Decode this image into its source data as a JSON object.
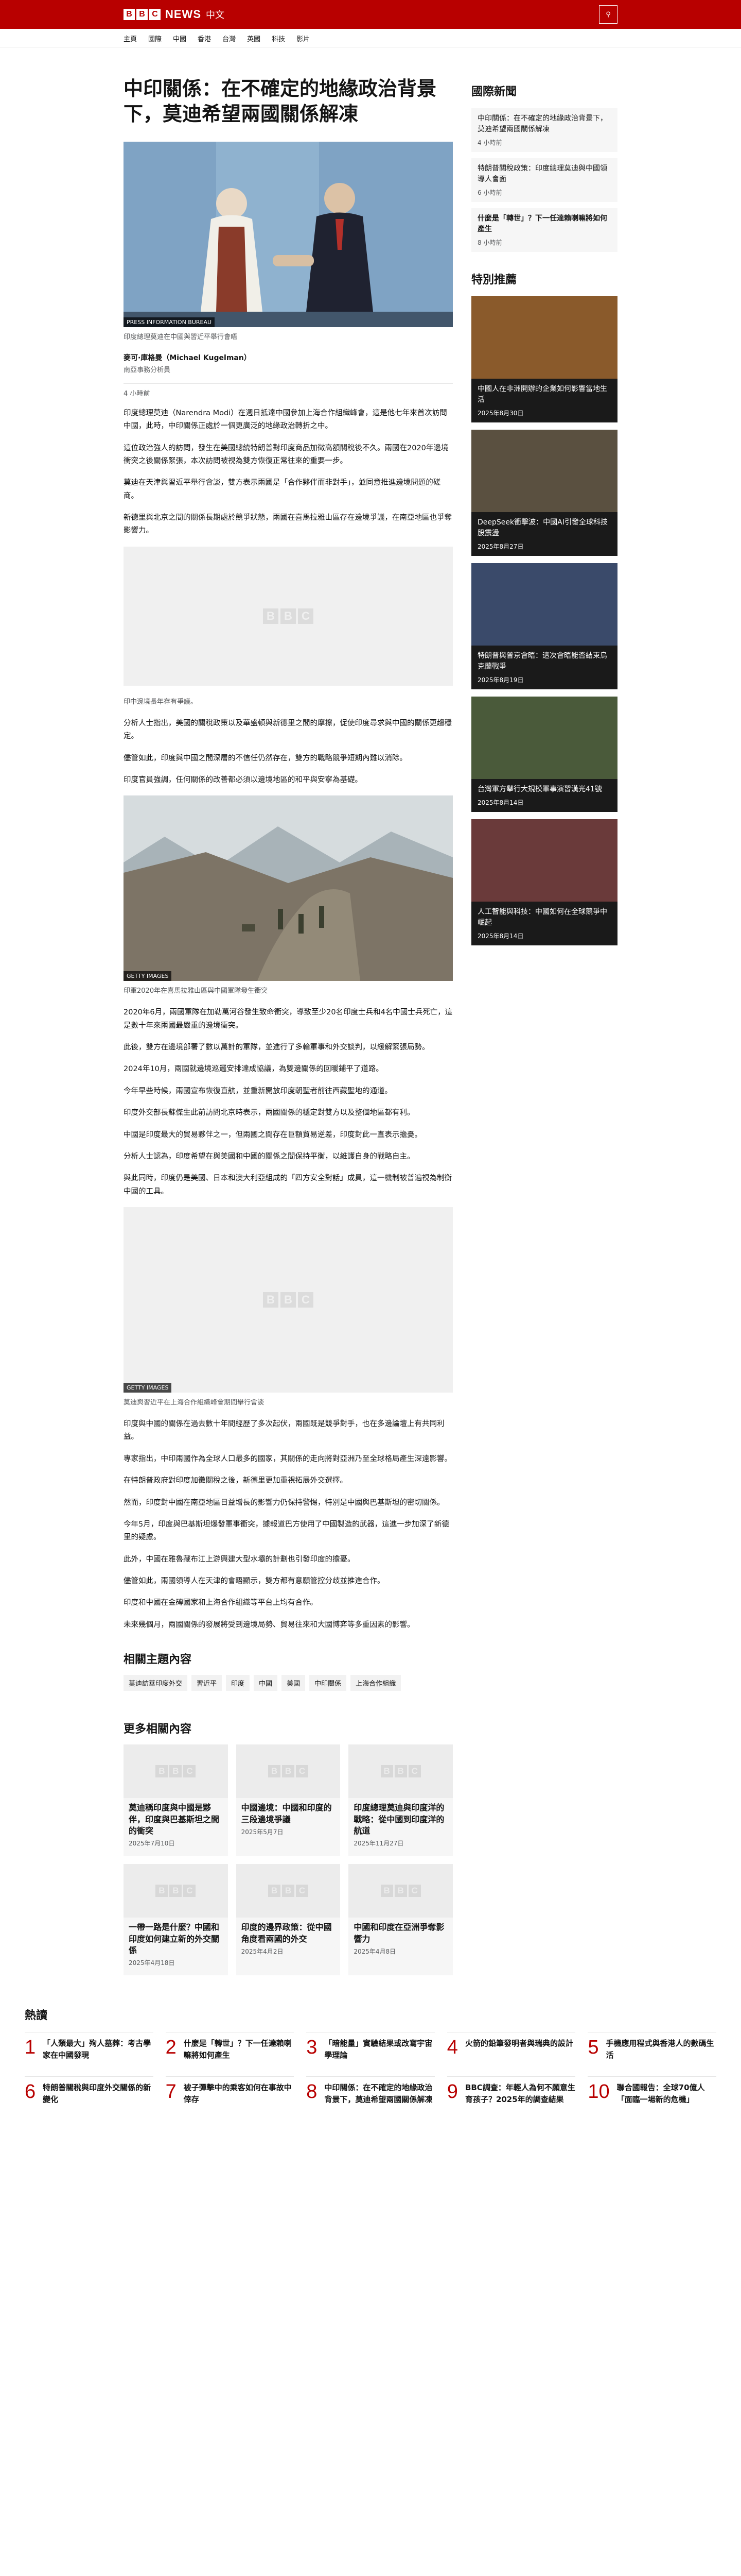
{
  "brand": {
    "letters": [
      "B",
      "B",
      "C"
    ],
    "news": "NEWS",
    "zh": "中文"
  },
  "nav": [
    "主頁",
    "國際",
    "中國",
    "香港",
    "台灣",
    "英國",
    "科技",
    "影片"
  ],
  "article": {
    "title": "中印關係：在不確定的地緣政治背景下，莫迪希望兩國關係解凍",
    "hero_credit": "PRESS INFORMATION BUREAU",
    "hero_caption": "印度總理莫迪在中國與習近平舉行會晤",
    "author": "麥可·庫格曼（Michael Kugelman）",
    "author_role": "南亞事務分析員",
    "date": "4 小時前",
    "paragraphs_a": [
      "印度總理莫迪（Narendra Modi）在週日抵達中國參加上海合作組織峰會，這是他七年來首次訪問中國，此時，中印關係正處於一個更廣泛的地緣政治轉折之中。",
      "這位政治強人的訪問，發生在美國總統特朗普對印度商品加徵高額關稅後不久。兩國在2020年邊境衝突之後關係緊張，本次訪問被視為雙方恢復正常往來的重要一步。",
      "莫迪在天津與習近平舉行會談，雙方表示兩國是「合作夥伴而非對手」，並同意推進邊境問題的磋商。",
      "新德里與北京之間的關係長期處於競爭狀態，兩國在喜馬拉雅山區存在邊境爭議，在南亞地區也爭奪影響力。"
    ],
    "ph1_caption": "印中邊境長年存有爭議。",
    "paragraphs_b": [
      "分析人士指出，美國的關稅政策以及華盛頓與新德里之間的摩擦，促使印度尋求與中國的關係更趨穩定。",
      "儘管如此，印度與中國之間深層的不信任仍然存在，雙方的戰略競爭短期內難以消除。",
      "印度官員強調，任何關係的改善都必須以邊境地區的和平與安寧為基礎。"
    ],
    "fig2_credit": "GETTY IMAGES",
    "fig2_caption": "印軍2020年在喜馬拉雅山區與中國軍隊發生衝突",
    "paragraphs_c": [
      "2020年6月，兩國軍隊在加勒萬河谷發生致命衝突，導致至少20名印度士兵和4名中國士兵死亡，這是數十年來兩國最嚴重的邊境衝突。",
      "此後，雙方在邊境部署了數以萬計的軍隊，並進行了多輪軍事和外交談判，以緩解緊張局勢。",
      "2024年10月，兩國就邊境巡邏安排達成協議，為雙邊關係的回暖鋪平了道路。",
      "今年早些時候，兩國宣布恢復直航，並重新開放印度朝聖者前往西藏聖地的通道。",
      "印度外交部長蘇傑生此前訪問北京時表示，兩國關係的穩定對雙方以及整個地區都有利。",
      "中國是印度最大的貿易夥伴之一，但兩國之間存在巨額貿易逆差，印度對此一直表示擔憂。",
      "分析人士認為，印度希望在與美國和中國的關係之間保持平衡，以維護自身的戰略自主。",
      "與此同時，印度仍是美國、日本和澳大利亞組成的「四方安全對話」成員，這一機制被普遍視為制衡中國的工具。"
    ],
    "ph2_credit": "GETTY IMAGES",
    "ph2_caption": "莫迪與習近平在上海合作組織峰會期間舉行會談",
    "paragraphs_d": [
      "印度與中國的關係在過去數十年間經歷了多次起伏，兩國既是競爭對手，也在多邊論壇上有共同利益。",
      "專家指出，中印兩國作為全球人口最多的國家，其關係的走向將對亞洲乃至全球格局產生深遠影響。",
      "在特朗普政府對印度加徵關稅之後，新德里更加重視拓展外交選擇。",
      "然而，印度對中國在南亞地區日益增長的影響力仍保持警惕，特別是中國與巴基斯坦的密切關係。",
      "今年5月，印度與巴基斯坦爆發軍事衝突，據報道巴方使用了中國製造的武器，這進一步加深了新德里的疑慮。",
      "此外，中國在雅魯藏布江上游興建大型水壩的計劃也引發印度的擔憂。",
      "儘管如此，兩國領導人在天津的會晤顯示，雙方都有意願管控分歧並推進合作。",
      "印度和中國在金磚國家和上海合作組織等平台上均有合作。",
      "未來幾個月，兩國關係的發展將受到邊境局勢、貿易往來和大國博弈等多重因素的影響。"
    ]
  },
  "related_topics": {
    "title": "相關主題內容",
    "tags": [
      "莫迪訪華印度外交",
      "習近平",
      "印度",
      "中國",
      "美國",
      "中印關係",
      "上海合作組織"
    ]
  },
  "more": {
    "title": "更多相關內容",
    "cards": [
      {
        "title": "莫迪稱印度與中國是夥伴，印度與巴基斯坦之間的衝突",
        "date": "2025年7月10日"
      },
      {
        "title": "中國邊境：中國和印度的三段邊境爭議",
        "date": "2025年5月7日"
      },
      {
        "title": "印度總理莫迪與印度洋的戰略：從中國到印度洋的航道",
        "date": "2025年11月27日"
      },
      {
        "title": "一帶一路是什麼？中國和印度如何建立新的外交關係",
        "date": "2025年4月18日"
      },
      {
        "title": "印度的邊界政策：從中國角度看兩國的外交",
        "date": "2025年4月2日"
      },
      {
        "title": "中國和印度在亞洲爭奪影響力",
        "date": "2025年4月8日"
      }
    ]
  },
  "side": {
    "title": "國際新聞",
    "items": [
      {
        "title": "中印關係：在不確定的地緣政治背景下，莫迪希望兩國關係解凍",
        "date": "4 小時前"
      },
      {
        "title": "特朗普關稅政策：印度總理莫迪與中國領導人會面",
        "date": "6 小時前"
      },
      {
        "title": "什麼是「轉世」？下一任達賴喇嘛將如何產生",
        "date": "8 小時前"
      }
    ],
    "feat_title": "特別推薦",
    "feats": [
      {
        "title": "中國人在非洲開辦的企業如何影響當地生活",
        "date": "2025年8月30日",
        "color": "#8a5a2b"
      },
      {
        "title": "DeepSeek衝擊波：中國AI引發全球科技股震盪",
        "date": "2025年8月27日",
        "color": "#5a5040"
      },
      {
        "title": "特朗普與普京會晤：這次會晤能否結束烏克蘭戰爭",
        "date": "2025年8月19日",
        "color": "#3a4a6a"
      },
      {
        "title": "台灣軍方舉行大規模軍事演習漢光41號",
        "date": "2025年8月14日",
        "color": "#4a5a3a"
      },
      {
        "title": "人工智能與科技：中國如何在全球競爭中崛起",
        "date": "2025年8月14日",
        "color": "#6a3a3a"
      }
    ]
  },
  "popular": {
    "title": "熱讀",
    "items": [
      {
        "n": "1",
        "title": "「人類最大」殉人墓葬：考古學家在中國發現",
        "date": ""
      },
      {
        "n": "2",
        "title": "什麼是「轉世」？下一任達賴喇嘛將如何產生",
        "date": ""
      },
      {
        "n": "3",
        "title": "「暗能量」實驗結果或改寫宇宙學理論",
        "date": ""
      },
      {
        "n": "4",
        "title": "火箭的鉛筆發明者與瑞典的設計",
        "date": ""
      },
      {
        "n": "5",
        "title": "手機應用程式與香港人的數碼生活",
        "date": ""
      },
      {
        "n": "6",
        "title": "特朗普關稅與印度外交關係的新變化",
        "date": ""
      },
      {
        "n": "7",
        "title": "被子彈擊中的乘客如何在事故中倖存",
        "date": ""
      },
      {
        "n": "8",
        "title": "中印關係：在不確定的地緣政治背景下，莫迪希望兩國關係解凍",
        "date": ""
      },
      {
        "n": "9",
        "title": "BBC調查：年輕人為何不願意生育孩子？2025年的調查結果",
        "date": ""
      },
      {
        "n": "10",
        "title": "聯合國報告：全球70億人「面臨一場新的危機」",
        "date": ""
      }
    ]
  }
}
